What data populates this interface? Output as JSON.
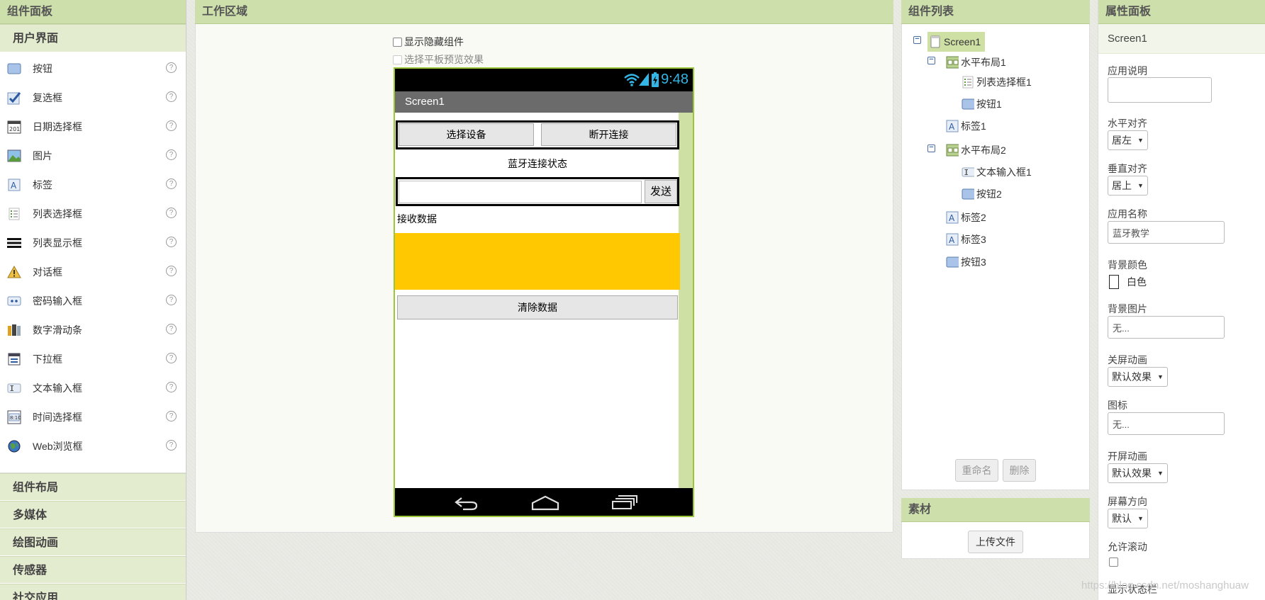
{
  "palette": {
    "title": "组件面板",
    "open_category": "用户界面",
    "items": [
      {
        "label": "按钮",
        "icon": "button-icon"
      },
      {
        "label": "复选框",
        "icon": "checkbox-icon"
      },
      {
        "label": "日期选择框",
        "icon": "calendar-icon"
      },
      {
        "label": "图片",
        "icon": "image-icon"
      },
      {
        "label": "标签",
        "icon": "label-icon"
      },
      {
        "label": "列表选择框",
        "icon": "list-picker-icon"
      },
      {
        "label": "列表显示框",
        "icon": "list-view-icon"
      },
      {
        "label": "对话框",
        "icon": "warning-icon"
      },
      {
        "label": "密码输入框",
        "icon": "password-icon"
      },
      {
        "label": "数字滑动条",
        "icon": "slider-icon"
      },
      {
        "label": "下拉框",
        "icon": "spinner-icon"
      },
      {
        "label": "文本输入框",
        "icon": "textbox-icon"
      },
      {
        "label": "时间选择框",
        "icon": "clock-icon"
      },
      {
        "label": "Web浏览框",
        "icon": "globe-icon"
      }
    ],
    "help_glyph": "?",
    "categories": [
      "组件布局",
      "多媒体",
      "绘图动画",
      "传感器",
      "社交应用"
    ]
  },
  "work": {
    "title": "工作区域",
    "show_hidden": "显示隐藏组件",
    "tablet_preview": "选择平板预览效果",
    "phone": {
      "time": "9:48",
      "screen_title": "Screen1",
      "select_device": "选择设备",
      "disconnect": "断开连接",
      "bt_status": "蓝牙连接状态",
      "send": "发送",
      "receive_label": "接收数据",
      "clear": "清除数据",
      "receive_color": "#ffc800"
    }
  },
  "components": {
    "title": "组件列表",
    "tree": {
      "screen": "Screen1",
      "hl1": "水平布局1",
      "listpicker1": "列表选择框1",
      "btn1": "按钮1",
      "label1": "标签1",
      "hl2": "水平布局2",
      "textbox1": "文本输入框1",
      "btn2": "按钮2",
      "label2": "标签2",
      "label3": "标签3",
      "btn3": "按钮3"
    },
    "collapse_glyph": "−",
    "rename": "重命名",
    "delete": "删除"
  },
  "media": {
    "title": "素材",
    "upload": "上传文件"
  },
  "properties": {
    "title": "属性面板",
    "component": "Screen1",
    "about_label": "应用说明",
    "about_value": "",
    "align_h_label": "水平对齐",
    "align_h_value": "居左",
    "align_v_label": "垂直对齐",
    "align_v_value": "居上",
    "app_name_label": "应用名称",
    "app_name_value": "蓝牙教学",
    "bg_color_label": "背景颜色",
    "bg_color_value": "白色",
    "bg_image_label": "背景图片",
    "bg_image_value": "无...",
    "close_anim_label": "关屏动画",
    "close_anim_value": "默认效果",
    "icon_label": "图标",
    "icon_value": "无...",
    "open_anim_label": "开屏动画",
    "open_anim_value": "默认效果",
    "orientation_label": "屏幕方向",
    "orientation_value": "默认",
    "scrollable_label": "允许滚动",
    "status_bar_label": "显示状态栏"
  },
  "watermark": "https://blog.csdn.net/moshanghuaw",
  "colors": {
    "accent": "#cddfaa",
    "phone_border": "#9cc63a",
    "selected": "#cfe0a5"
  }
}
